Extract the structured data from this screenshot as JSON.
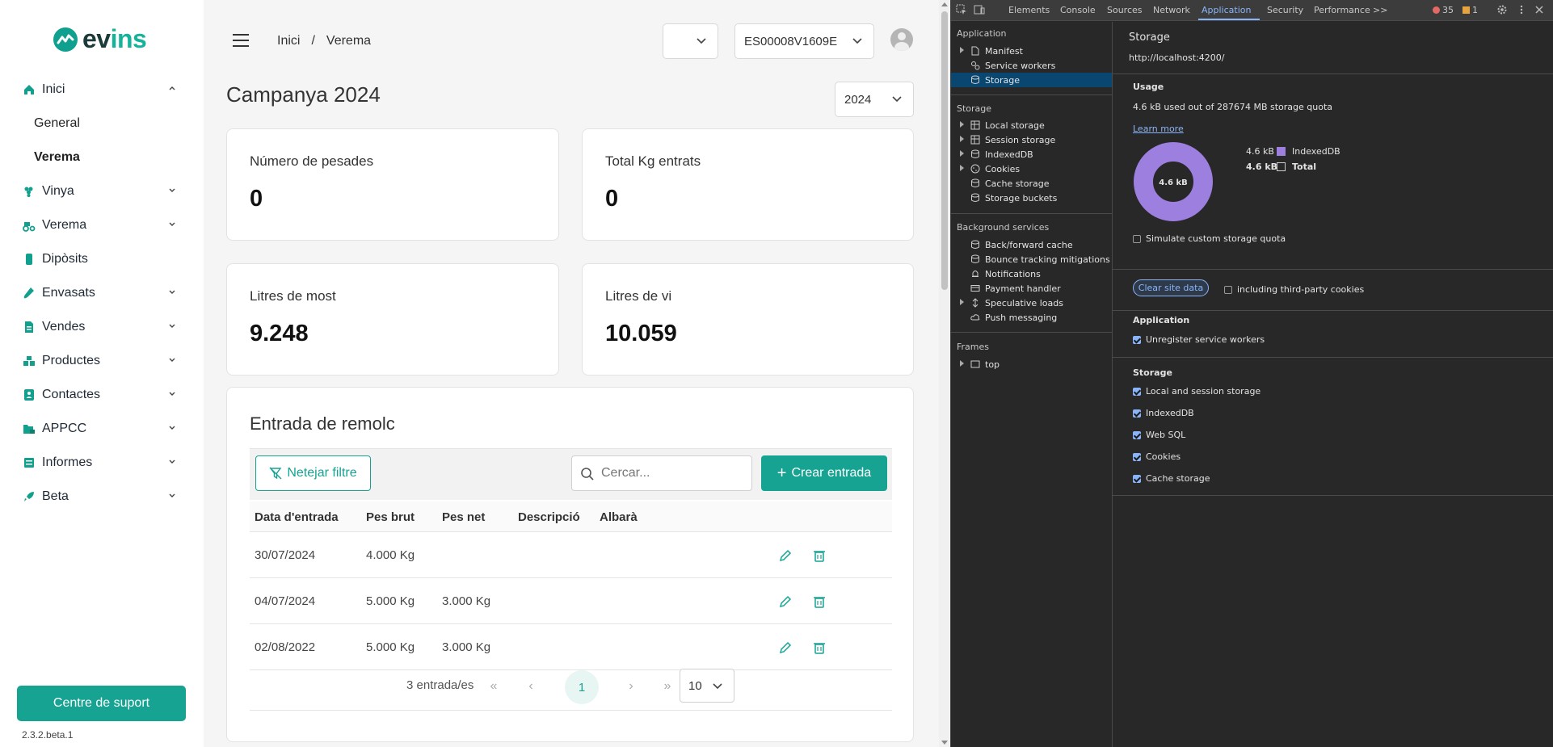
{
  "app": {
    "logo_text_a": "ev",
    "logo_text_b": "ins",
    "sidebar": {
      "items": [
        {
          "label": "Inici",
          "icon": "home-icon",
          "expanded": true
        },
        {
          "label": "Vinya",
          "icon": "grape-icon"
        },
        {
          "label": "Verema",
          "icon": "tractor-icon"
        },
        {
          "label": "Dipòsits",
          "icon": "tank-icon"
        },
        {
          "label": "Envasats",
          "icon": "bottle-icon"
        },
        {
          "label": "Vendes",
          "icon": "document-icon"
        },
        {
          "label": "Productes",
          "icon": "boxes-icon"
        },
        {
          "label": "Contactes",
          "icon": "contact-card-icon"
        },
        {
          "label": "APPCC",
          "icon": "folder-lock-icon"
        },
        {
          "label": "Informes",
          "icon": "report-icon"
        },
        {
          "label": "Beta",
          "icon": "rocket-icon"
        }
      ],
      "subitems": [
        {
          "label": "General",
          "active": false
        },
        {
          "label": "Verema",
          "active": true
        }
      ],
      "support_label": "Centre de suport",
      "version": "2.3.2.beta.1"
    },
    "topbar": {
      "breadcrumb": [
        "Inici",
        "/",
        "Verema"
      ],
      "selector_value": "",
      "id_selector_value": "ES00008V1609E"
    },
    "page": {
      "title": "Campanya 2024",
      "year_value": "2024"
    },
    "stats": [
      {
        "label": "Número de pesades",
        "value": "0"
      },
      {
        "label": "Total Kg entrats",
        "value": "0"
      },
      {
        "label": "Litres de most",
        "value": "9.248"
      },
      {
        "label": "Litres de vi",
        "value": "10.059"
      }
    ],
    "table": {
      "title": "Entrada de remolc",
      "clear_filter_label": "Netejar filtre",
      "search_placeholder": "Cercar...",
      "create_label": "Crear entrada",
      "columns": [
        "Data d'entrada",
        "Pes brut",
        "Pes net",
        "Descripció",
        "Albarà"
      ],
      "rows": [
        {
          "date": "30/07/2024",
          "gross": "4.000 Kg",
          "net": "",
          "desc": "",
          "albara": ""
        },
        {
          "date": "04/07/2024",
          "gross": "5.000 Kg",
          "net": "3.000 Kg",
          "desc": "",
          "albara": ""
        },
        {
          "date": "02/08/2022",
          "gross": "5.000 Kg",
          "net": "3.000 Kg",
          "desc": "",
          "albara": ""
        }
      ],
      "pager": {
        "count_text": "3 entrada/es",
        "current_page": "1",
        "page_size": "10"
      }
    },
    "colors": {
      "accent": "#16a392",
      "text": "#1f2a36"
    }
  },
  "devtools": {
    "tabs": [
      "Elements",
      "Console",
      "Sources",
      "Network",
      "Application",
      "Security",
      "Performance"
    ],
    "active_tab": "Application",
    "more_tabs_label": ">>",
    "errors": "35",
    "warnings": "1",
    "sidebar": {
      "application_label": "Application",
      "application_items": [
        "Manifest",
        "Service workers",
        "Storage"
      ],
      "storage_label": "Storage",
      "storage_items": [
        "Local storage",
        "Session storage",
        "IndexedDB",
        "Cookies",
        "Cache storage",
        "Storage buckets"
      ],
      "background_label": "Background services",
      "background_items": [
        "Back/forward cache",
        "Bounce tracking mitigations",
        "Notifications",
        "Payment handler",
        "Speculative loads",
        "Push messaging"
      ],
      "frames_label": "Frames",
      "frames_items": [
        "top"
      ]
    },
    "main": {
      "title": "Storage",
      "url": "http://localhost:4200/",
      "usage_heading": "Usage",
      "usage_text": "4.6 kB used out of 287674 MB storage quota",
      "learn_more": "Learn more",
      "donut_label": "4.6 kB",
      "legend": [
        {
          "size": "4.6 kB",
          "name": "IndexedDB",
          "color": "#9d7fe0"
        },
        {
          "size": "4.6 kB",
          "name": "Total",
          "color": ""
        }
      ],
      "simulate_label": "Simulate custom storage quota",
      "clear_label": "Clear site data",
      "third_party_label": "including third-party cookies",
      "application_heading": "Application",
      "unregister_label": "Unregister service workers",
      "storage_heading": "Storage",
      "storage_checks": [
        "Local and session storage",
        "IndexedDB",
        "Web SQL",
        "Cookies",
        "Cache storage"
      ]
    }
  }
}
